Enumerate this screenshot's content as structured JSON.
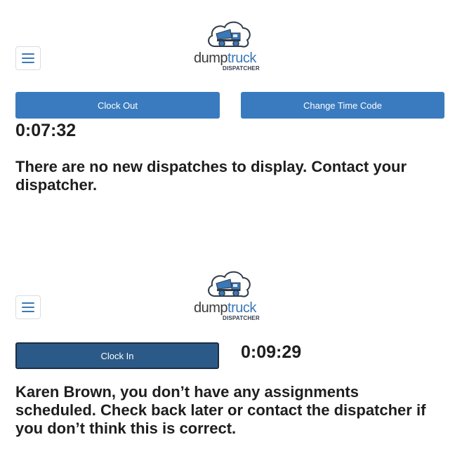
{
  "screen1": {
    "logo": {
      "word_dump": "dump",
      "word_truck": "truck",
      "sub": "DISPATCHER"
    },
    "clock_out_label": "Clock Out",
    "change_time_code_label": "Change Time Code",
    "timer": "0:07:32",
    "message": "There are no new dispatches to display. Contact your dispatcher."
  },
  "screen2": {
    "logo": {
      "word_dump": "dump",
      "word_truck": "truck",
      "sub": "DISPATCHER"
    },
    "clock_in_label": "Clock In",
    "timer": "0:09:29",
    "message": "Karen Brown, you don’t have any assignments scheduled. Check back later or contact the dispatcher if you don’t think this is correct."
  },
  "colors": {
    "accent": "#3a7bbf",
    "accent_dark": "#2c5a88",
    "text": "#1e1e1e"
  },
  "icons": {
    "menu": "hamburger-menu-icon",
    "logo": "dump-truck-cloud-logo"
  }
}
